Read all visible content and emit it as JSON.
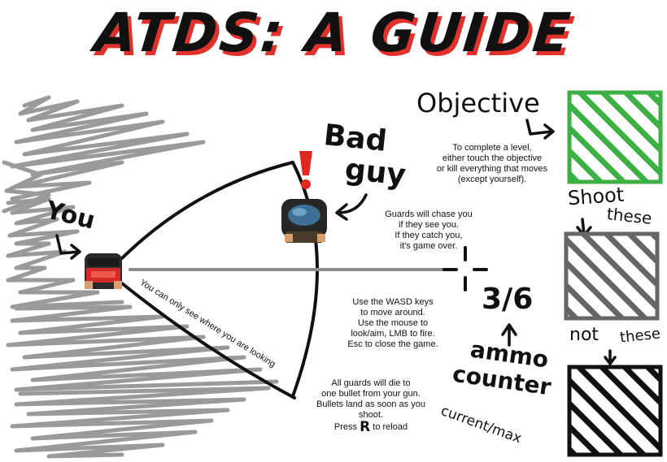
{
  "title": "ATDS: A GUIDE",
  "labels": {
    "you": "You",
    "bad_guy_line1": "Bad",
    "bad_guy_line2": "guy",
    "objective": "Objective",
    "shoot_line1": "Shoot",
    "shoot_line2": "these",
    "not_word": "not",
    "these_word": "these",
    "ammo_line1": "ammo",
    "ammo_line2": "counter",
    "ammo_sub": "current/max",
    "vision_cone": "You can only see where you are looking"
  },
  "ammo": {
    "display": "3/6",
    "current": 3,
    "max": 6
  },
  "objective_text": [
    "To complete a level,",
    "either touch the objective",
    "or kill everything that moves",
    "(except yourself)."
  ],
  "guard_text": [
    "Guards will chase you",
    "if they see you.",
    "If they catch you,",
    "it's game over."
  ],
  "controls_text": [
    "Use the WASD keys",
    "to move around.",
    "Use the mouse to",
    "look/aim, LMB to fire.",
    "Esc to close the game."
  ],
  "bullets_text": [
    "All guards will die to",
    "one bullet from your gun.",
    "Bullets land as soon as you",
    "shoot."
  ],
  "reload": {
    "before": "Press",
    "key": "R",
    "after": "to reload"
  },
  "colors": {
    "title_shadow": "#e0312a",
    "objective_box": "#3cb043",
    "shoot_box": "#666666",
    "not_box": "#111111",
    "scribble": "#9a9a9a",
    "player_red": "#d22a2a",
    "guard_blue": "#3d6f94",
    "alert_red": "#e0281e"
  },
  "icons": [
    "exclamation-icon",
    "crosshair-icon",
    "player-sprite",
    "guard-sprite"
  ]
}
